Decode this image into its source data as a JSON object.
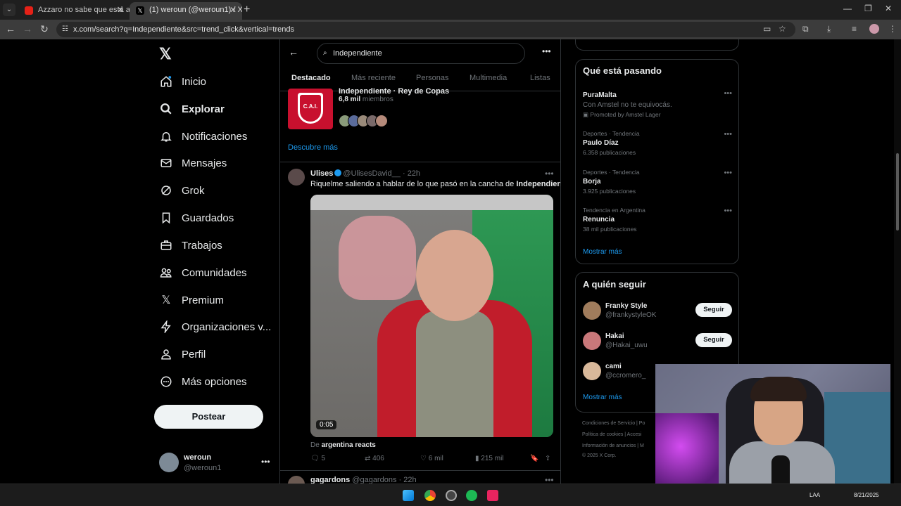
{
  "browser": {
    "tabs": [
      {
        "title": "Azzaro no sabe que está al aire",
        "active": false
      },
      {
        "title": "(1) weroun (@weroun1) / X",
        "active": true
      }
    ],
    "url": "x.com/search?q=Independiente&src=trend_click&vertical=trends"
  },
  "sidebar": {
    "items": [
      {
        "label": "Inicio",
        "icon": "home-icon"
      },
      {
        "label": "Explorar",
        "icon": "search-icon"
      },
      {
        "label": "Notificaciones",
        "icon": "bell-icon"
      },
      {
        "label": "Mensajes",
        "icon": "mail-icon"
      },
      {
        "label": "Grok",
        "icon": "grok-icon"
      },
      {
        "label": "Guardados",
        "icon": "bookmark-icon"
      },
      {
        "label": "Trabajos",
        "icon": "briefcase-icon"
      },
      {
        "label": "Comunidades",
        "icon": "people-icon"
      },
      {
        "label": "Premium",
        "icon": "x-logo-icon"
      },
      {
        "label": "Organizaciones v...",
        "icon": "lightning-icon"
      },
      {
        "label": "Perfil",
        "icon": "person-icon"
      },
      {
        "label": "Más opciones",
        "icon": "more-circle-icon"
      }
    ],
    "post_button": "Postear",
    "account": {
      "name": "weroun",
      "handle": "@weroun1"
    }
  },
  "search": {
    "query": "Independiente",
    "tabs": [
      "Destacado",
      "Más reciente",
      "Personas",
      "Multimedia",
      "Listas"
    ]
  },
  "community": {
    "title": "Independiente · Rey de Copas",
    "members_count": "6,8 mil",
    "members_label": "miembros",
    "crest_text": "C.A.I.",
    "discover": "Descubre más"
  },
  "tweet": {
    "name": "Ulises",
    "handle": "@UlisesDavid__",
    "time": "22h",
    "text_before": "Riquelme saliendo a hablar de lo que pasó en la cancha de ",
    "text_bold": "Independiente",
    "text_after": ":",
    "video_duration": "0:05",
    "from_label": "De",
    "from_source": "argentina reacts",
    "replies": "5",
    "reposts": "406",
    "likes": "6 mil",
    "views": "215 mil"
  },
  "tweet2": {
    "name": "gagardons",
    "handle": "@gagardons",
    "time": "22h"
  },
  "trending": {
    "title": "Qué está pasando",
    "promo": {
      "name": "PuraMalta",
      "text": "Con Amstel no te equivocás.",
      "promoted": "Promoted by Amstel Lager"
    },
    "items": [
      {
        "category": "Deportes · Tendencia",
        "name": "Paulo Díaz",
        "count": "6.358 publicaciones"
      },
      {
        "category": "Deportes · Tendencia",
        "name": "Borja",
        "count": "3.925 publicaciones"
      },
      {
        "category": "Tendencia en Argentina",
        "name": "Renuncia",
        "count": "38 mil publicaciones"
      }
    ],
    "show_more": "Mostrar más"
  },
  "who_to_follow": {
    "title": "A quién seguir",
    "users": [
      {
        "name": "Franky Style",
        "handle": "@frankystyleOK",
        "button": "Seguir"
      },
      {
        "name": "Hakai",
        "handle": "@Hakai_uwu",
        "button": "Seguir"
      },
      {
        "name": "cami",
        "handle": "@ccromero_",
        "button": ""
      }
    ],
    "show_more": "Mostrar más"
  },
  "footer": {
    "line1": "Condiciones de Servicio  |  Po",
    "line2": "Política de cookies  |  Accesi",
    "line3": "Información de anuncios  |  M",
    "line4": "© 2025 X Corp."
  },
  "taskbar": {
    "lang": "LAA",
    "date": "8/21/2025"
  }
}
